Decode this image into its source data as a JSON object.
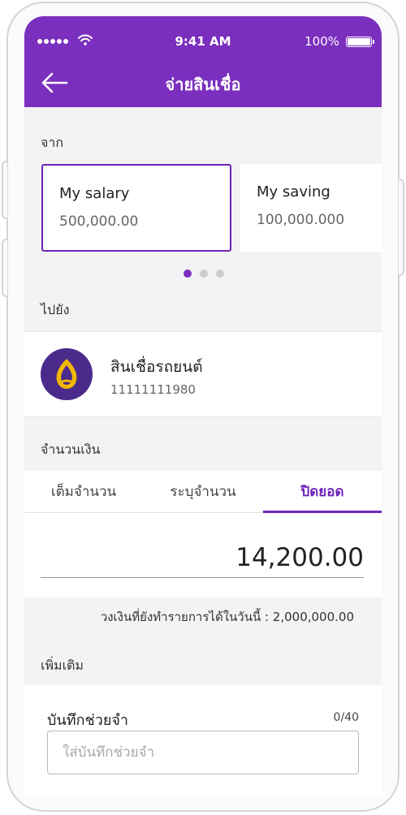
{
  "status_bar": {
    "time": "9:41 AM",
    "battery": "100%"
  },
  "header": {
    "title": "จ่ายสินเชื่อ"
  },
  "from": {
    "label": "จาก",
    "accounts": [
      {
        "name": "My salary",
        "balance": "500,000.00",
        "selected": true
      },
      {
        "name": "My saving",
        "balance": "100,000.000",
        "selected": false
      }
    ],
    "pager": {
      "count": 3,
      "active": 1
    }
  },
  "to": {
    "label": "ไปยัง",
    "name": "สินเชื่อรถยนต์",
    "account": "11111111980"
  },
  "amount": {
    "label": "จำนวนเงิน",
    "tabs": [
      {
        "label": "เต็มจำนวน",
        "active": false
      },
      {
        "label": "ระบุจำนวน",
        "active": false
      },
      {
        "label": "ปิดยอด",
        "active": true
      }
    ],
    "value": "14,200.00",
    "limit_text": "วงเงินที่ยังทำรายการได้ในวันนี้ : 2,000,000.00"
  },
  "extra": {
    "label": "เพิ่มเติม",
    "memo_label": "บันทึกช่วยจำ",
    "memo_count": "0/40",
    "memo_value": "",
    "memo_placeholder": "ใส่บันทึกช่วยจำ"
  },
  "colors": {
    "brand": "#7b2fbe",
    "accent": "#6e24b8",
    "background": "#f3f3f5"
  },
  "icons": {
    "back": "arrow-left-icon",
    "wifi": "wifi-icon",
    "battery": "battery-icon",
    "logo": "bank-logo-icon"
  }
}
